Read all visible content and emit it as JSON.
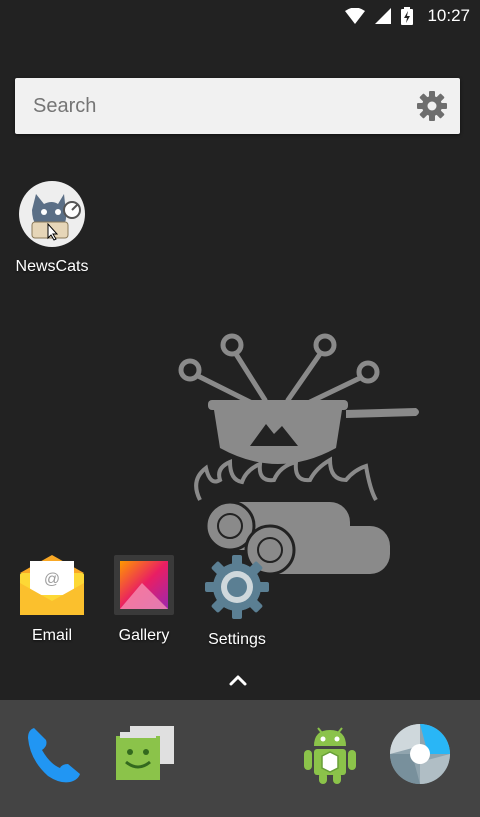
{
  "status_bar": {
    "time": "10:27",
    "icons": [
      "wifi-icon",
      "signal-icon",
      "battery-charging-icon"
    ]
  },
  "search": {
    "placeholder": "Search",
    "icon": "gear-icon"
  },
  "desktop_apps": [
    {
      "label": "NewsCats",
      "icon": "newscats-icon"
    }
  ],
  "home_row_apps": [
    {
      "label": "Email",
      "icon": "email-icon"
    },
    {
      "label": "Gallery",
      "icon": "gallery-icon"
    },
    {
      "label": "Settings",
      "icon": "settings-icon"
    }
  ],
  "all_apps_indicator": "chevron-up-icon",
  "dock": [
    {
      "icon": "phone-icon"
    },
    {
      "icon": "messaging-icon"
    },
    {
      "icon": "android-icon"
    },
    {
      "icon": "camera-icon"
    }
  ],
  "colors": {
    "background": "#222222",
    "dock": "#444444",
    "search_bar": "#f1f1f1",
    "phone_blue": "#2196f3",
    "messaging_green": "#8bc34a",
    "email_yellow": "#fdd835"
  }
}
